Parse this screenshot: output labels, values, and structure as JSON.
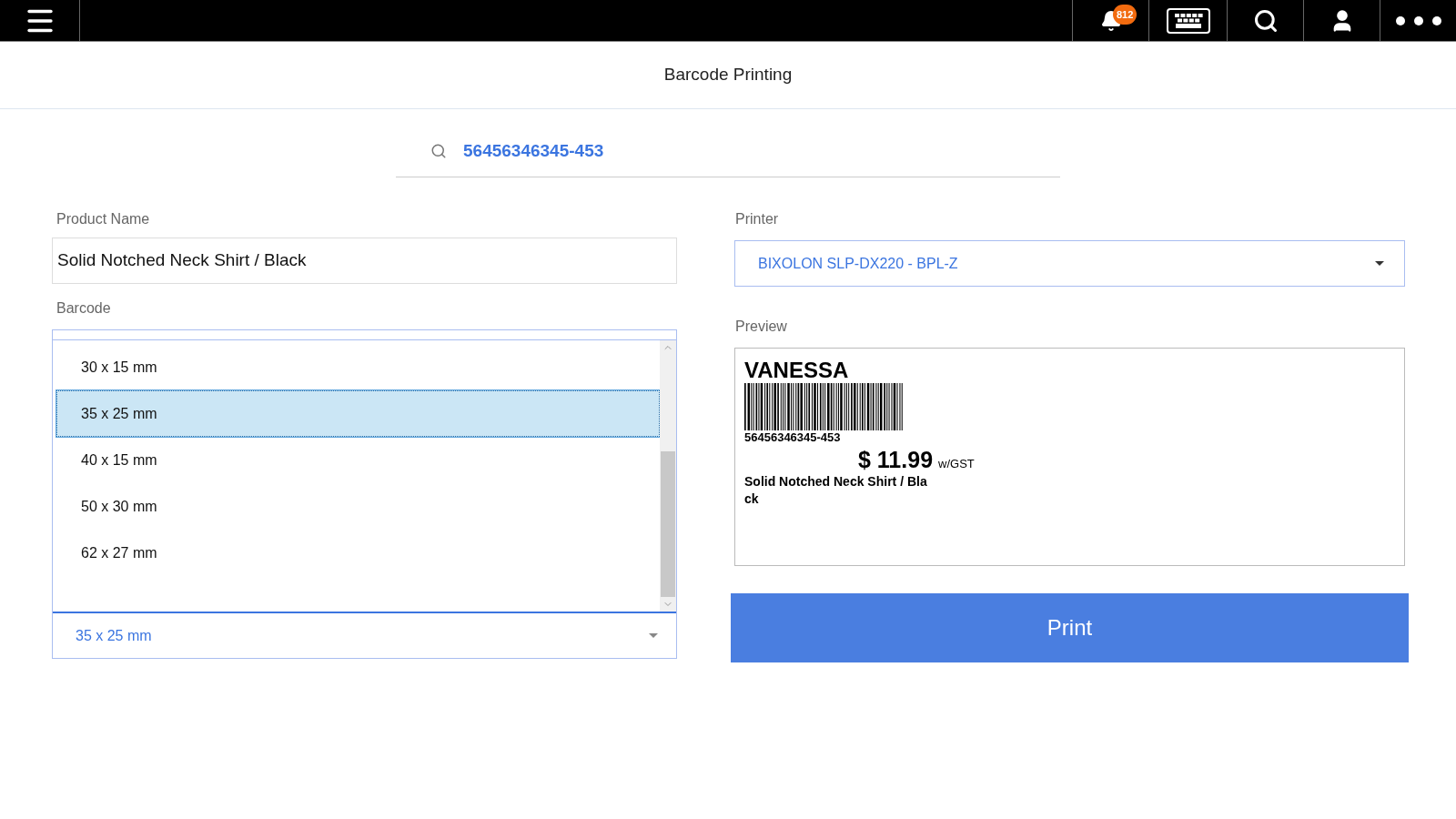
{
  "top_bar": {
    "notification_count": "812"
  },
  "page_title": "Barcode Printing",
  "search": {
    "value": "56456346345-453"
  },
  "product_name": {
    "label": "Product Name",
    "value": "Solid Notched Neck Shirt / Black"
  },
  "barcode": {
    "label": "Barcode",
    "options": [
      {
        "label": "30 x 15 mm",
        "selected": false
      },
      {
        "label": "35 x 25 mm",
        "selected": true
      },
      {
        "label": "40 x 15 mm",
        "selected": false
      },
      {
        "label": "50 x 30 mm",
        "selected": false
      },
      {
        "label": "62 x 27 mm",
        "selected": false
      }
    ],
    "value": "35 x 25 mm"
  },
  "printer": {
    "label": "Printer",
    "value": "BIXOLON SLP-DX220 - BPL-Z"
  },
  "preview": {
    "label": "Preview",
    "brand": "VANESSA",
    "barcode_number": "56456346345-453",
    "price": "$ 11.99",
    "price_note": "w/GST",
    "name_lines": [
      "Solid Notched Neck Shirt / Bla",
      "ck"
    ]
  },
  "print_button": "Print"
}
